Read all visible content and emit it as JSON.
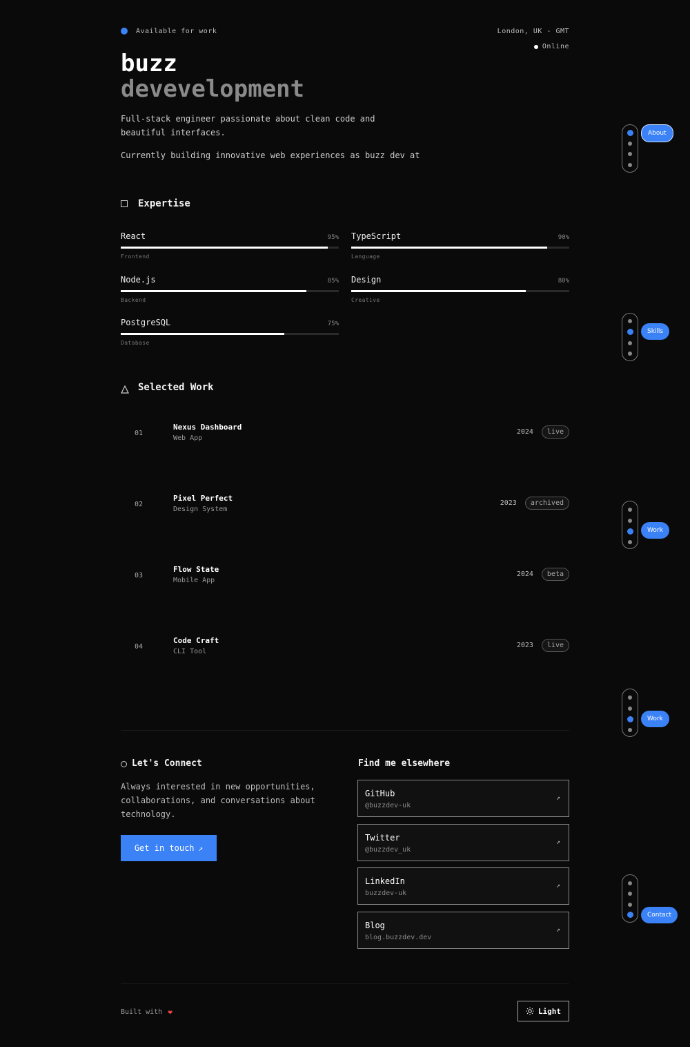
{
  "header": {
    "availability": "Available for work",
    "location": "London, UK - GMT",
    "status": "Online",
    "name_line1": "buzz",
    "name_line2": "devevelopment",
    "intro": "Full-stack engineer passionate about clean code and beautiful interfaces.",
    "current": "Currently building innovative web experiences as buzz dev at"
  },
  "expertise": {
    "title": "Expertise",
    "skills": [
      {
        "name": "React",
        "percent_label": "95%",
        "level": 95,
        "category": "Frontend"
      },
      {
        "name": "TypeScript",
        "percent_label": "90%",
        "level": 90,
        "category": "Language"
      },
      {
        "name": "Node.js",
        "percent_label": "85%",
        "level": 85,
        "category": "Backend"
      },
      {
        "name": "Design",
        "percent_label": "80%",
        "level": 80,
        "category": "Creative"
      },
      {
        "name": "PostgreSQL",
        "percent_label": "75%",
        "level": 75,
        "category": "Database"
      }
    ]
  },
  "work": {
    "title": "Selected Work",
    "projects": [
      {
        "num": "01",
        "name": "Nexus Dashboard",
        "type": "Web App",
        "year": "2024",
        "status": "live"
      },
      {
        "num": "02",
        "name": "Pixel Perfect",
        "type": "Design System",
        "year": "2023",
        "status": "archived"
      },
      {
        "num": "03",
        "name": "Flow State",
        "type": "Mobile App",
        "year": "2024",
        "status": "beta"
      },
      {
        "num": "04",
        "name": "Code Craft",
        "type": "CLI Tool",
        "year": "2023",
        "status": "live"
      }
    ]
  },
  "nav": {
    "about": "About",
    "skills": "Skills",
    "work": "Work",
    "work2": "Work",
    "contact": "Contact"
  },
  "connect": {
    "title": "Let's Connect",
    "text": "Always interested in new opportunities, collaborations, and conversations about technology.",
    "cta": "Get in touch",
    "cta_icon": "↗"
  },
  "elsewhere": {
    "title": "Find me elsewhere",
    "links": [
      {
        "name": "GitHub",
        "handle": "@buzzdev-uk"
      },
      {
        "name": "Twitter",
        "handle": "@buzzdev_uk"
      },
      {
        "name": "LinkedIn",
        "handle": "buzzdev-uk"
      },
      {
        "name": "Blog",
        "handle": "blog.buzzdev.dev"
      }
    ],
    "arrow": "↗"
  },
  "footer": {
    "built_with": "Built with",
    "heart": "❤",
    "theme_button": "Light"
  },
  "colors": {
    "accent": "#3b82f6",
    "background": "#0a0a0a"
  }
}
